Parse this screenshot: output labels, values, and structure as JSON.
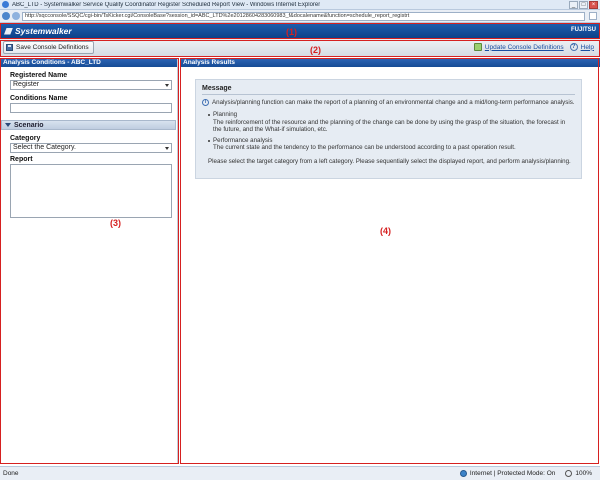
{
  "window": {
    "title": "ABC_LTD - Systemwalker Service Quality Coordinator Register Scheduled Report View - Windows Internet Explorer"
  },
  "browser": {
    "url": "http://sqcconsole/SSQC/cgi-bin/TsKicker.cgi/ConsoleBase?session_id=ABC_LTD%2e20128604283060983_f&docalename&function=schedule_report_registrt"
  },
  "app": {
    "logo": "Systemwalker",
    "vendor": "FUJITSU"
  },
  "toolbar": {
    "save_label": "Save Console Definitions",
    "update_label": "Update Console Definitions",
    "help_label": "Help"
  },
  "left": {
    "panel_title": "Analysis Conditions - ABC_LTD",
    "registered_name_label": "Registered Name",
    "registered_name_value": "Register",
    "conditions_name_label": "Conditions Name",
    "conditions_name_value": "",
    "scenario_label": "Scenario",
    "category_label": "Category",
    "category_value": "Select the Category.",
    "report_label": "Report"
  },
  "right": {
    "panel_title": "Analysis Results",
    "message_heading": "Message",
    "intro": "Analysis/planning function can make the report of a planning of an environmental change and a mid/long-term performance analysis.",
    "items": [
      {
        "title": "Planning",
        "text": "The reinforcement of the resource and the planning of the change can be done by using the grasp of the situation, the forecast in the future, and the What-if simulation, etc."
      },
      {
        "title": "Performance analysis",
        "text": "The current state and the tendency to the performance can be understood according to a past operation result."
      }
    ],
    "instruction": "Please select the target category from a left category. Please sequentially select the displayed report, and perform analysis/planning."
  },
  "annotations": {
    "region1": "(1)",
    "region2": "(2)",
    "region3": "(3)",
    "region4": "(4)"
  },
  "status": {
    "left": "Done",
    "zone": "Internet | Protected Mode: On",
    "zoom": "100%"
  },
  "colors": {
    "header_blue": "#1a4f9c",
    "annotation_red": "#d62020",
    "message_bg": "#e6ecf3"
  }
}
